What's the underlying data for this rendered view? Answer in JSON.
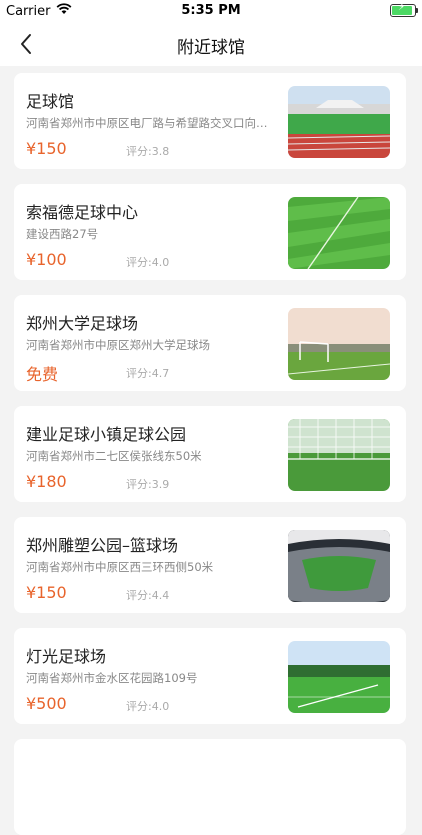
{
  "status": {
    "carrier": "Carrier",
    "time": "5:35 PM"
  },
  "nav": {
    "title": "附近球馆"
  },
  "venues": [
    {
      "name": "足球馆",
      "address": "河南省郑州市中原区电厂路与希望路交叉口向西…",
      "price": "¥150",
      "score": "评分:3.8",
      "image": "stadium-with-track"
    },
    {
      "name": "索福德足球中心",
      "address": "建设西路27号",
      "price": "¥100",
      "score": "评分:4.0",
      "image": "striped-grass-field"
    },
    {
      "name": "郑州大学足球场",
      "address": "河南省郑州市中原区郑州大学足球场",
      "price": "免费",
      "score": "评分:4.7",
      "image": "field-with-goal"
    },
    {
      "name": "建业足球小镇足球公园",
      "address": "河南省郑州市二七区侯张线东50米",
      "price": "¥180",
      "score": "评分:3.9",
      "image": "goal-net-closeup"
    },
    {
      "name": "郑州雕塑公园–篮球场",
      "address": "河南省郑州市中原区西三环西侧50米",
      "price": "¥150",
      "score": "评分:4.4",
      "image": "indoor-stadium"
    },
    {
      "name": "灯光足球场",
      "address": "河南省郑州市金水区花园路109号",
      "price": "¥500",
      "score": "评分:4.0",
      "image": "field-with-trees"
    }
  ]
}
